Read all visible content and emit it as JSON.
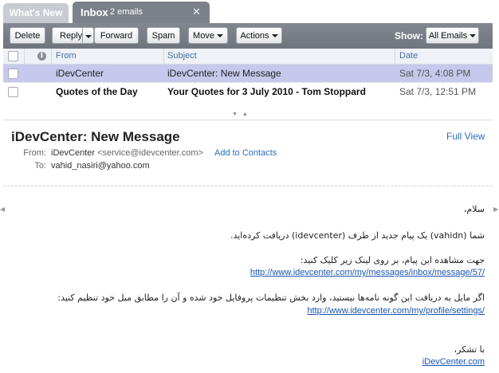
{
  "tabs": {
    "whats_new": "What's New",
    "inbox": "Inbox",
    "inbox_count": "2 emails",
    "close": "✕"
  },
  "toolbar": {
    "delete": "Delete",
    "reply": "Reply",
    "forward": "Forward",
    "spam": "Spam",
    "move": "Move",
    "actions": "Actions",
    "show_label": "Show:",
    "show_value": "All Emails"
  },
  "list": {
    "columns": {
      "from": "From",
      "subject": "Subject",
      "date": "Date"
    },
    "rows": [
      {
        "from": "iDevCenter",
        "subject": "iDevCenter: New Message",
        "date": "Sat 7/3, 4:08 PM"
      },
      {
        "from": "Quotes of the Day",
        "subject": "Your Quotes for 3 July 2010 - Tom Stoppard",
        "date": "Sat 7/3, 12:51 PM"
      }
    ]
  },
  "preview": {
    "title": "iDevCenter: New Message",
    "full_view": "Full View",
    "from_label": "From:",
    "from_name": "iDevCenter",
    "from_addr": "<service@idevcenter.com>",
    "add_contacts": "Add to Contacts",
    "to_label": "To:",
    "to_value": "vahid_nasiri@yahoo.com",
    "body": {
      "greeting": "سلام،",
      "line1": "شما (vahidn) یک پیام جدید از طرف (idevcenter) دریافت کرده‌اید.",
      "line2": "جهت مشاهده این پیام، بر روی لینک زیر کلیک کنید:",
      "link1": "http://www.idevcenter.com/my/messages/inbox/message/57/",
      "line3": "اگر مایل به دریافت این گونه نامه‌ها نیستید، وارد بخش تنظیمات پروفایل خود شده و آن را مطابق میل خود تنظیم کنید:",
      "link2": "http://www.idevcenter.com/my/profile/settings/",
      "thanks": "با تشکر،",
      "signature": "iDevCenter.com"
    }
  },
  "colors": {
    "toolbar": "#777c84",
    "selected_row": "#c6c9eb",
    "link": "#2a6ebb",
    "tab_active": "#7c8189"
  }
}
